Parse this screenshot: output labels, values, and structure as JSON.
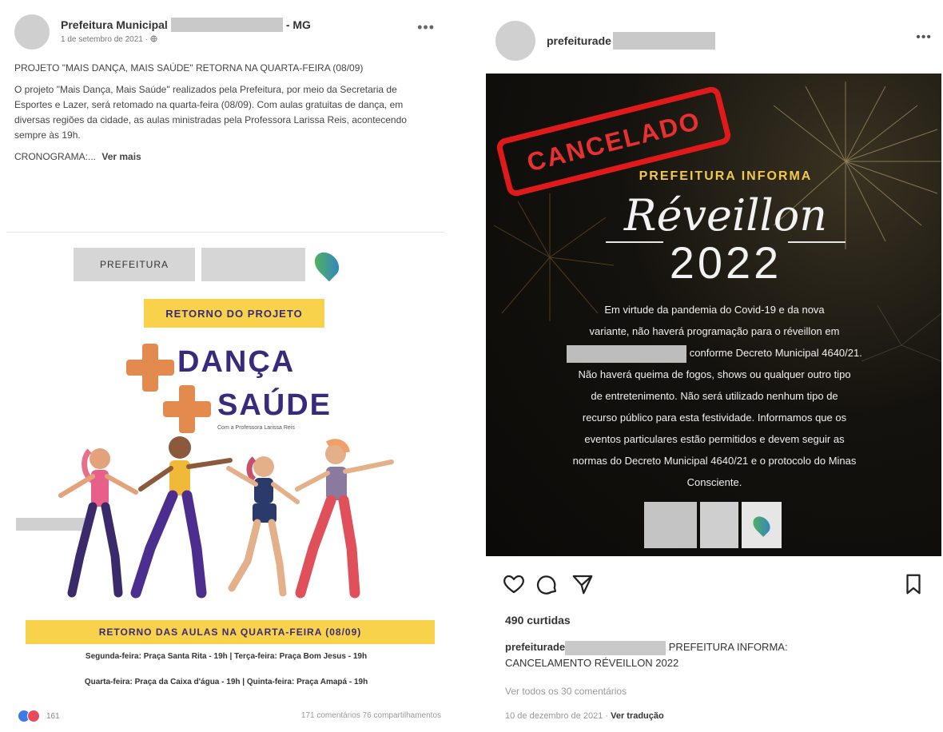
{
  "facebook_post": {
    "author_prefix": "Prefeitura Municipal",
    "author_suffix": "- MG",
    "date": "1 de setembro de 2021 · ",
    "globe_icon": "globe-icon",
    "title": "PROJETO \"MAIS DANÇA, MAIS SAÚDE\" RETORNA NA QUARTA-FEIRA (08/09)",
    "body": "O projeto \"Mais Dança, Mais Saúde\" realizados pela Prefeitura, por meio da Secretaria de Esportes e Lazer, será retomado na quarta-feira (08/09). Com aulas gratuitas de dança, em diversas regiões da cidade, as aulas ministradas pela Professora Larissa Reis, acontecendo sempre às 19h.",
    "cronograma": "CRONOGRAMA:...",
    "see_more": "Ver mais",
    "poster": {
      "logo_text": "PREFEITURA",
      "retorno": "RETORNO DO PROJETO",
      "danca": "DANÇA",
      "saude": "SAÚDE",
      "subline": "Com a Professora Larissa Reis",
      "aulas": "RETORNO DAS AULAS NA QUARTA-FEIRA (08/09)",
      "schedule_1": "Segunda-feira: Praça Santa Rita - 19h | Terça-feira: Praça Bom Jesus - 19h",
      "schedule_2": "Quarta-feira: Praça da Caixa d'água - 19h | Quinta-feira: Praça Amapá - 19h"
    },
    "reaction_count": "161",
    "stats": "171 comentários  76 compartilhamentos"
  },
  "instagram_post": {
    "username": "prefeiturade",
    "image": {
      "stamp": "CANCELADO",
      "prefeitura_informa": "PREFEITURA INFORMA",
      "reveillon": "Réveillon",
      "year": "2022",
      "line_1": "Em virtude da pandemia do Covid-19 e da nova",
      "line_2": "variante, não haverá programação para o réveillon em",
      "line_3": "conforme Decreto Municipal 4640/21.",
      "line_4": "Não haverá queima de fogos, shows ou qualquer outro tipo",
      "line_5": "de entretenimento. Não será utilizado nenhum tipo de",
      "line_6": "recurso público para esta festividade. Informamos que os",
      "line_7": "eventos particulares estão permitidos e devem seguir as",
      "line_8": "normas do Decreto Municipal 4640/21 e o protocolo do Minas",
      "line_9": "Consciente."
    },
    "likes": "490 curtidas",
    "caption_user": "prefeiturade",
    "caption_text": "PREFEITURA INFORMA:",
    "caption_line_2": "CANCELAMENTO RÉVEILLON 2022",
    "view_comments": "Ver todos os 30 comentários",
    "date": "10 de dezembro de 2021 · ",
    "see_translation": "Ver tradução",
    "icons": {
      "like": "heart-icon",
      "comment": "comment-icon",
      "share": "send-icon",
      "save": "bookmark-icon"
    }
  }
}
